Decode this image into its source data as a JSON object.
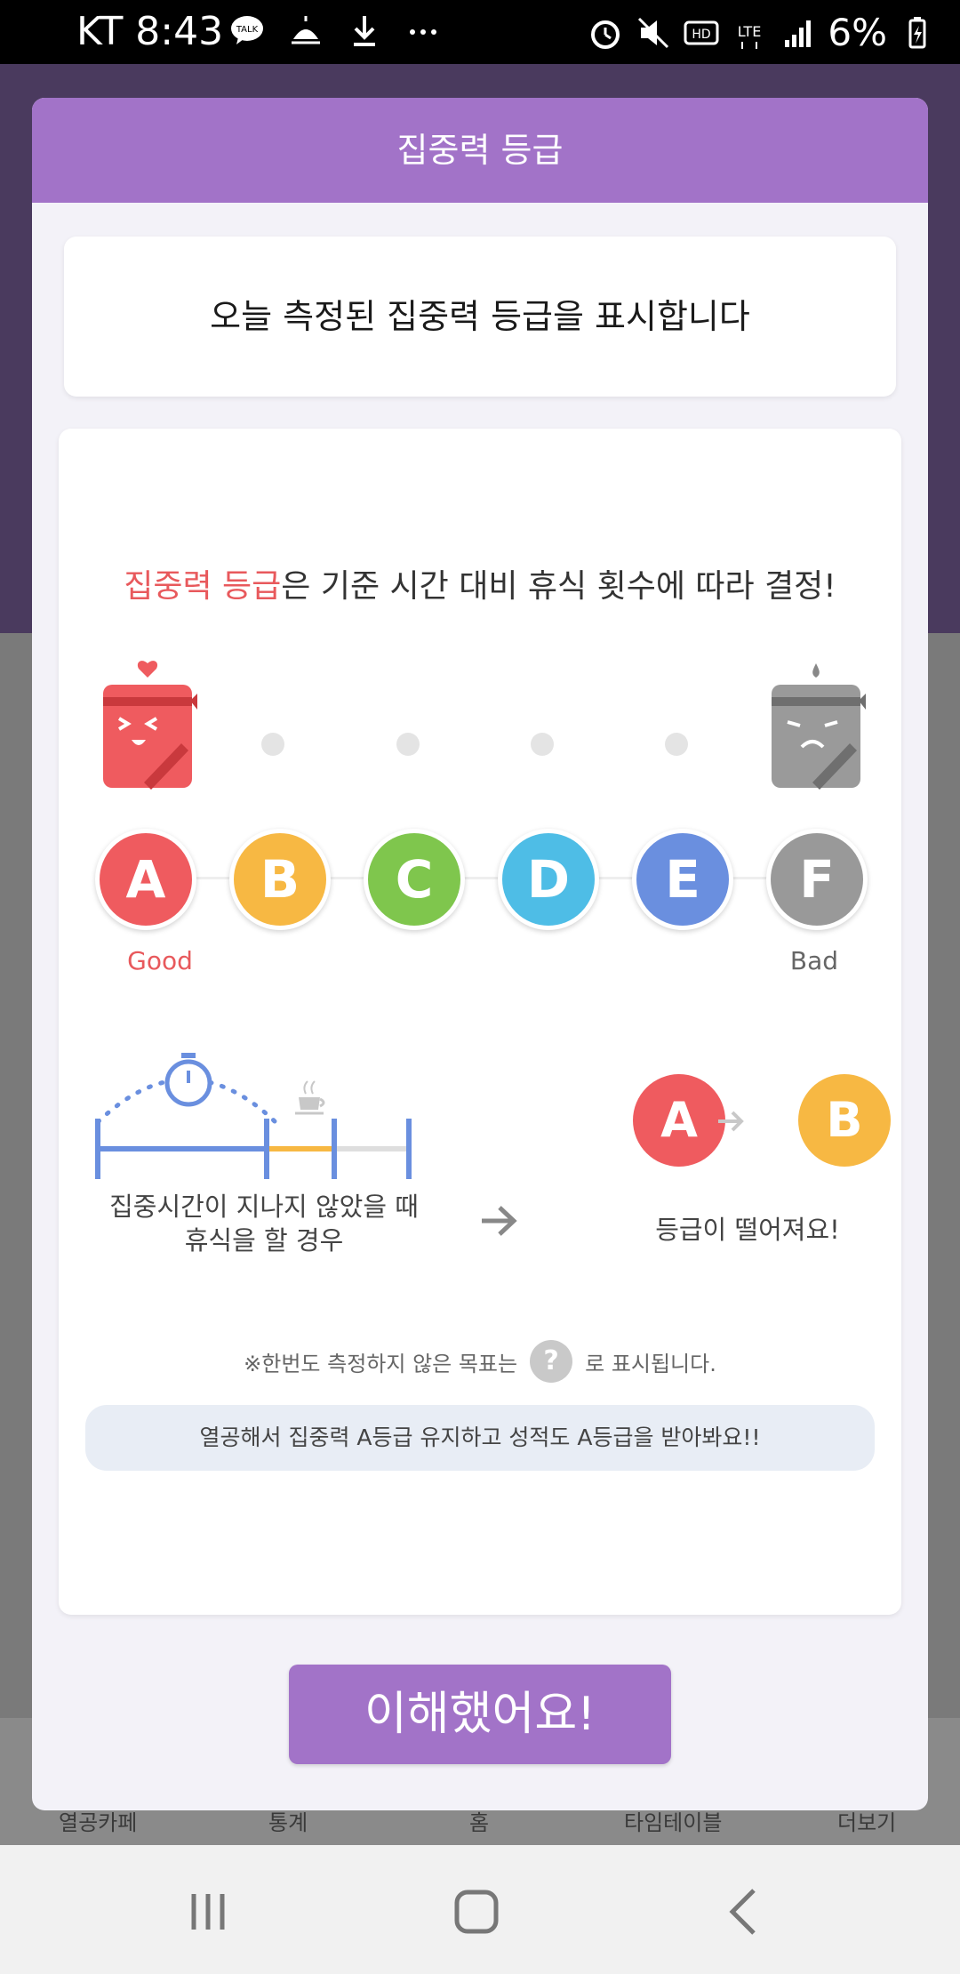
{
  "status_bar": {
    "carrier_time": "KT 8:43",
    "battery": "6%",
    "icons_left": [
      "talk-icon",
      "weather-icon",
      "download-icon",
      "more-dots-icon"
    ],
    "icons_right": [
      "alarm-icon",
      "mute-icon",
      "hd-icon",
      "lte-icon",
      "signal-icon",
      "battery-icon"
    ]
  },
  "background_tabs": [
    "열공카페",
    "통계",
    "홈",
    "타임테이블",
    "더보기"
  ],
  "modal": {
    "title": "집중력 등급",
    "description": "오늘 측정된 집중력 등급을 표시합니다",
    "headline_highlight": "집중력 등급",
    "headline_rest": "은 기준 시간 대비 휴식 횟수에 따라 결정!",
    "grades": [
      {
        "letter": "A",
        "color": "#ef5b5f"
      },
      {
        "letter": "B",
        "color": "#f7b843"
      },
      {
        "letter": "C",
        "color": "#7fc64d"
      },
      {
        "letter": "D",
        "color": "#4ebde6"
      },
      {
        "letter": "E",
        "color": "#6a8fdf"
      },
      {
        "letter": "F",
        "color": "#999999"
      }
    ],
    "good_label": "Good",
    "bad_label": "Bad",
    "caption_left_line1": "집중시간이 지나지 않았을 때",
    "caption_left_line2": "휴식을 할 경우",
    "example_from": "A",
    "example_to": "B",
    "caption_right": "등급이 떨어져요!",
    "note_before": "※한번도 측정하지 않은 목표는",
    "note_icon": "?",
    "note_after": "로 표시됩니다.",
    "tip": "열공해서 집중력 A등급 유지하고 성적도 A등급을 받아봐요!!",
    "confirm_label": "이해했어요!"
  },
  "colors": {
    "accent_purple": "#a273c8",
    "highlight_red": "#e8595c",
    "timeline_blue": "#6a8fdf",
    "timeline_orange": "#f7b843"
  }
}
